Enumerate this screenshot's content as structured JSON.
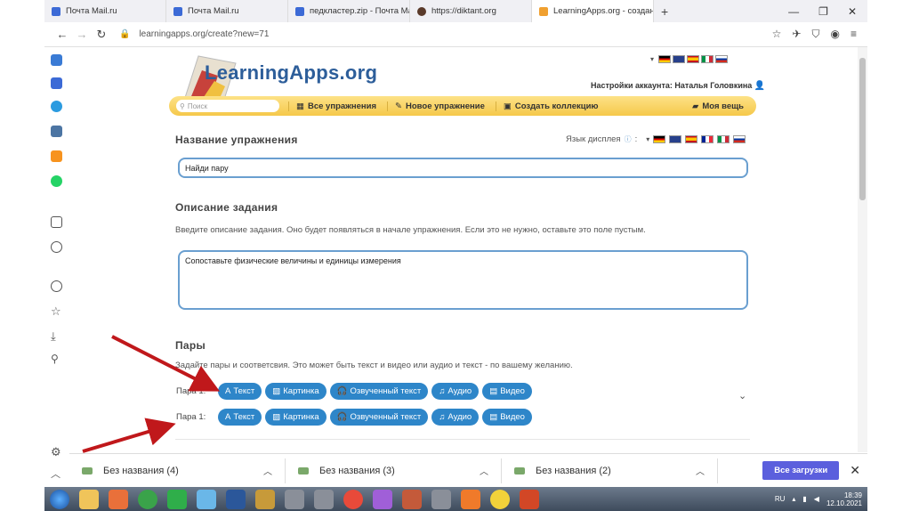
{
  "tabs": [
    {
      "title": "Почта Mail.ru",
      "color": "#3c6ad6"
    },
    {
      "title": "Почта Mail.ru",
      "color": "#3c6ad6"
    },
    {
      "title": "педкластер.zip - Почта Mail.r",
      "color": "#3c6ad6"
    },
    {
      "title": "https://diktant.org",
      "color": "#5a3a2a"
    },
    {
      "title": "LearningApps.org - создание",
      "color": "#f0a030",
      "active": true
    }
  ],
  "address": {
    "url": "learningapps.org/create?new=71"
  },
  "logo": {
    "text": "LearningApps.org"
  },
  "account": {
    "text": "Настройки аккаунта: Наталья Головкина"
  },
  "menu": {
    "search_placeholder": "Поиск",
    "all_exercises": "Все упражнения",
    "new_exercise": "Новое упражнение",
    "create_collection": "Создать коллекцию",
    "my_stuff": "Моя вещь"
  },
  "form": {
    "title_heading": "Название упражнения",
    "display_language": "Язык дисплея",
    "title_value": "Найди пару",
    "desc_heading": "Описание задания",
    "desc_help": "Введите описание задания. Оно будет появляться в начале упражнения. Если это не нужно, оставьте это поле пустым.",
    "desc_value": "Сопоставьте физические величины и единицы измерения",
    "pairs_heading": "Пары",
    "pairs_help": "Задайте пары и соответсвия. Это может быть текст и видео или аудио и текст - по вашему желанию.",
    "pairs": [
      {
        "label": "Пара 1:",
        "buttons": [
          "Текст",
          "Картинка",
          "Озвученный текст",
          "Аудио",
          "Видео"
        ]
      },
      {
        "label": "Пара 1:",
        "buttons": [
          "Текст",
          "Картинка",
          "Озвученный текст",
          "Аудио",
          "Видео"
        ]
      }
    ]
  },
  "downloads": {
    "items": [
      "Без названия (4)",
      "Без названия (3)",
      "Без названия (2)"
    ],
    "all_label": "Все загрузки"
  },
  "taskbar": {
    "lang": "RU",
    "time": "18:39",
    "date": "12.10.2021"
  },
  "colors": {
    "accent": "#2e86c9",
    "menu": "#f5c84a",
    "arrow": "#c0181b",
    "downloads_btn": "#5b5fdd"
  }
}
